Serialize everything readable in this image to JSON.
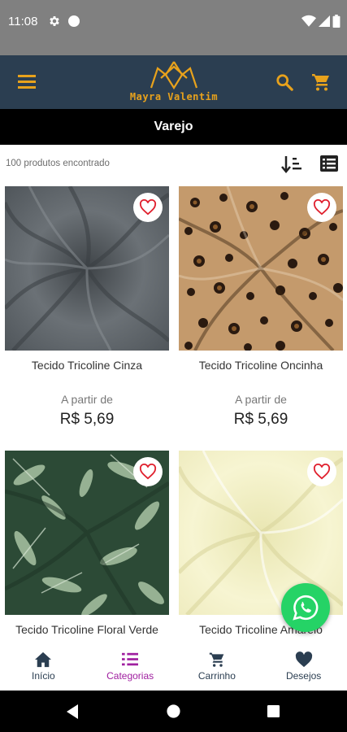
{
  "status": {
    "time": "11:08"
  },
  "header": {
    "brand": "Mayra Valentim"
  },
  "page": {
    "title": "Varejo"
  },
  "results": {
    "count_label": "100 produtos encontrado"
  },
  "products": [
    {
      "name": "Tecido Tricoline Cinza",
      "from_label": "A partir de",
      "price": "R$  5,69"
    },
    {
      "name": "Tecido Tricoline Oncinha",
      "from_label": "A partir de",
      "price": "R$  5,69"
    },
    {
      "name": "Tecido Tricoline Floral Verde",
      "from_label": "",
      "price": ""
    },
    {
      "name": "Tecido Tricoline Amarelo",
      "from_label": "",
      "price": ""
    }
  ],
  "bottom_nav": [
    {
      "label": "Início",
      "icon": "home-icon"
    },
    {
      "label": "Categorias",
      "icon": "list-icon",
      "active": true
    },
    {
      "label": "Carrinho",
      "icon": "cart-icon"
    },
    {
      "label": "Desejos",
      "icon": "heart-icon"
    }
  ],
  "colors": {
    "header": "#2b3e51",
    "accent": "#e8a21c",
    "active_tab": "#a020a0",
    "whatsapp": "#25d366"
  }
}
